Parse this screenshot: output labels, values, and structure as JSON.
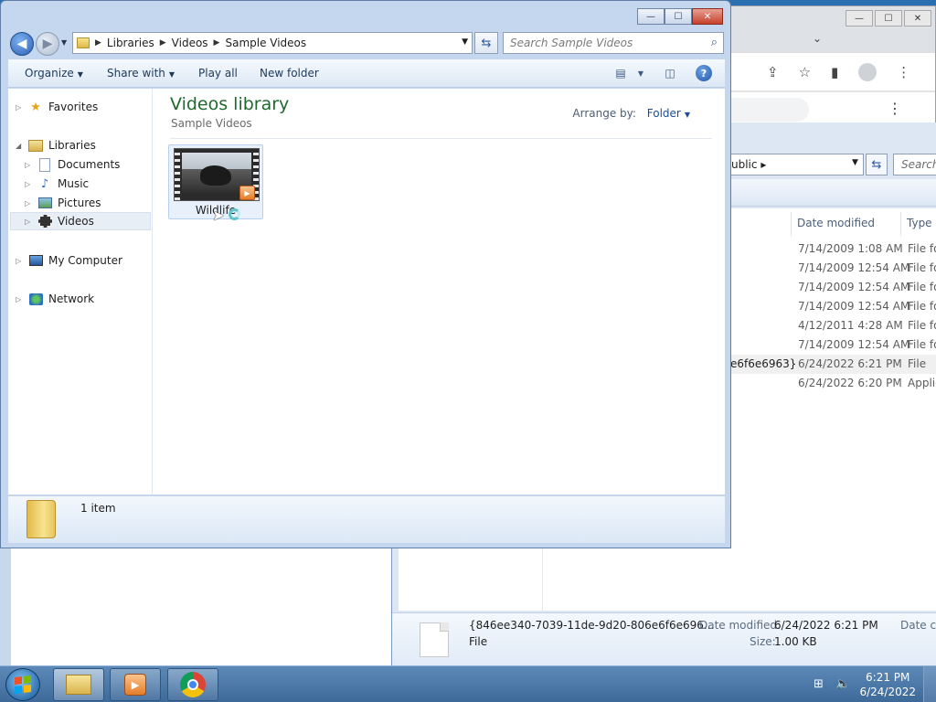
{
  "chrome_window": {
    "caption_buttons": [
      "—",
      "☐",
      "✕"
    ],
    "tab_chevron": "⌄",
    "toolbar_icons": [
      "share-icon",
      "star-icon",
      "sidepanel-icon",
      "profile-icon",
      "menu-icon"
    ],
    "menu_dots": "⋮"
  },
  "background_explorer": {
    "breadcrumb": "ublic",
    "search_placeholder": "Search",
    "columns": [
      "Date modified",
      "Type"
    ],
    "rows": [
      {
        "name": "",
        "date": "7/14/2009 1:08 AM",
        "type": "File fo"
      },
      {
        "name": "",
        "date": "7/14/2009 12:54 AM",
        "type": "File fo"
      },
      {
        "name": "",
        "date": "7/14/2009 12:54 AM",
        "type": "File fo"
      },
      {
        "name": "",
        "date": "7/14/2009 12:54 AM",
        "type": "File fo"
      },
      {
        "name": "",
        "date": "4/12/2011 4:28 AM",
        "type": "File fo"
      },
      {
        "name": "",
        "date": "7/14/2009 12:54 AM",
        "type": "File fo"
      },
      {
        "name": "e6f6e6963}",
        "date": "6/24/2022 6:21 PM",
        "type": "File"
      },
      {
        "name": "",
        "date": "6/24/2022 6:20 PM",
        "type": "Applic"
      }
    ],
    "details": {
      "filename": "{846ee340-7039-11de-9d20-806e6f6e696...",
      "filetype": "File",
      "date_modified_label": "Date modified:",
      "date_modified_value": "6/24/2022 6:21 PM",
      "size_label": "Size:",
      "size_value": "1.00 KB",
      "date_created_label": "Date cre"
    }
  },
  "window": {
    "caption_buttons": {
      "minimize": "—",
      "maximize": "☐",
      "close": "✕"
    },
    "breadcrumb": [
      "Libraries",
      "Videos",
      "Sample Videos"
    ],
    "search_placeholder": "Search Sample Videos",
    "toolbar": {
      "organize": "Organize",
      "share_with": "Share with",
      "play_all": "Play all",
      "new_folder": "New folder",
      "help": "?"
    },
    "nav": {
      "favorites": "Favorites",
      "libraries": "Libraries",
      "documents": "Documents",
      "music": "Music",
      "pictures": "Pictures",
      "videos": "Videos",
      "my_computer": "My Computer",
      "network": "Network"
    },
    "content": {
      "title": "Videos library",
      "subtitle": "Sample Videos",
      "arrange_label": "Arrange by:",
      "arrange_value": "Folder",
      "items": [
        {
          "name": "Wildlife",
          "icon": "video-thumbnail"
        }
      ]
    },
    "status": {
      "count_text": "1 item"
    }
  },
  "taskbar": {
    "buttons": [
      "windows-explorer",
      "windows-media-player",
      "google-chrome"
    ],
    "clock_time": "6:21 PM",
    "clock_date": "6/24/2022"
  }
}
